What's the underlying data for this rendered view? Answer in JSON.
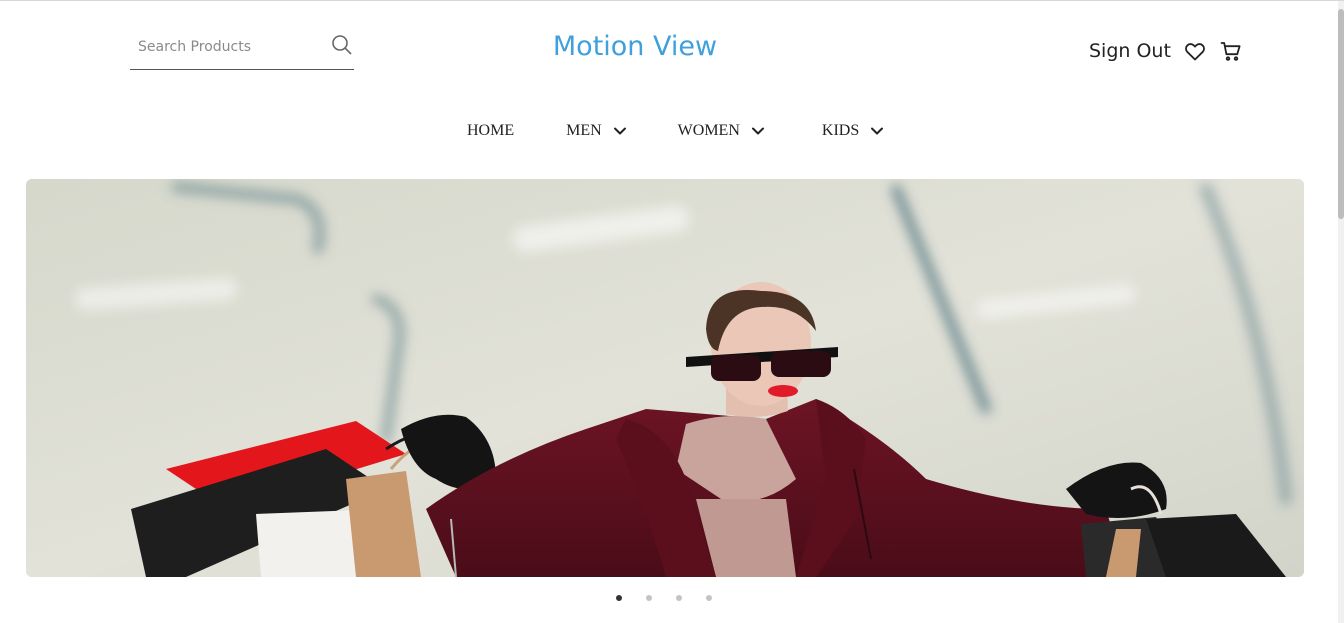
{
  "header": {
    "search": {
      "placeholder": "Search Products",
      "value": ""
    },
    "brand": "Motion View",
    "account": {
      "sign_out_label": "Sign Out",
      "icons": [
        "heart-icon",
        "cart-icon"
      ]
    }
  },
  "nav": {
    "items": [
      {
        "label": "HOME",
        "has_dropdown": false
      },
      {
        "label": "MEN",
        "has_dropdown": true
      },
      {
        "label": "WOMEN",
        "has_dropdown": true
      },
      {
        "label": "KIDS",
        "has_dropdown": true
      }
    ]
  },
  "carousel": {
    "slide_count": 4,
    "active_index": 0
  },
  "colors": {
    "brand": "#3fa0dc",
    "text": "#222222",
    "dot_active": "#333333",
    "dot_inactive": "#c4c4c4"
  }
}
